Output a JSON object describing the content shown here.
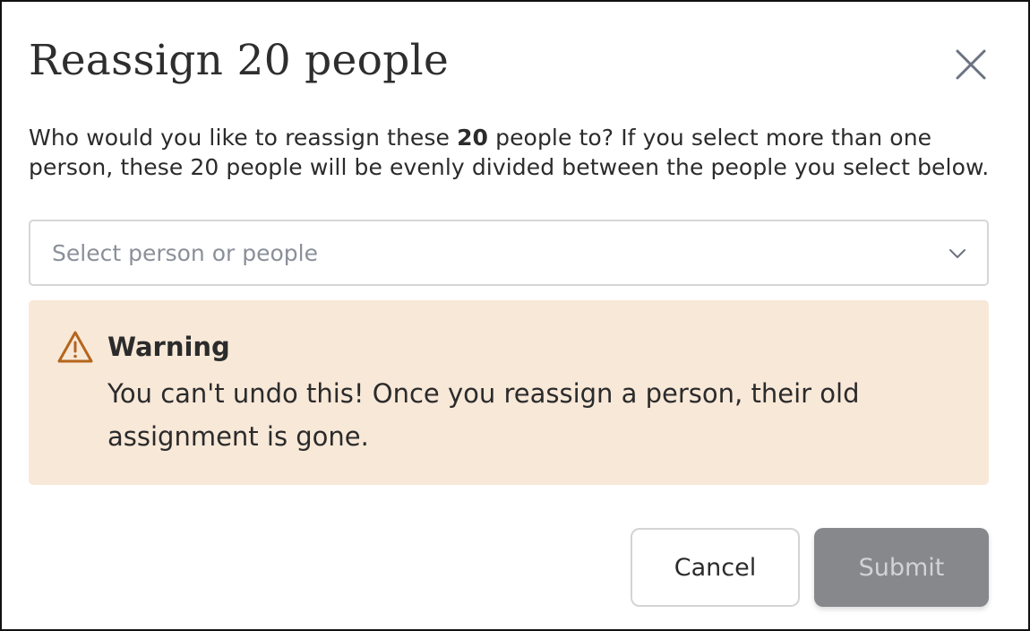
{
  "dialog": {
    "title": "Reassign 20 people",
    "close_icon": "close-icon",
    "description": {
      "before": "Who would you like to reassign these ",
      "count": "20",
      "after": " people to? If you select more than one person, these 20 people will be evenly divided between the people you select below."
    },
    "select": {
      "placeholder": "Select person or people",
      "icon": "chevron-down-icon"
    },
    "warning": {
      "icon": "warning-triangle-icon",
      "title": "Warning",
      "text": "You can't undo this! Once you reassign a person, their old assignment is gone.",
      "background_color": "#f8e8d8",
      "icon_color": "#b5651d"
    },
    "buttons": {
      "cancel_label": "Cancel",
      "submit_label": "Submit"
    }
  }
}
